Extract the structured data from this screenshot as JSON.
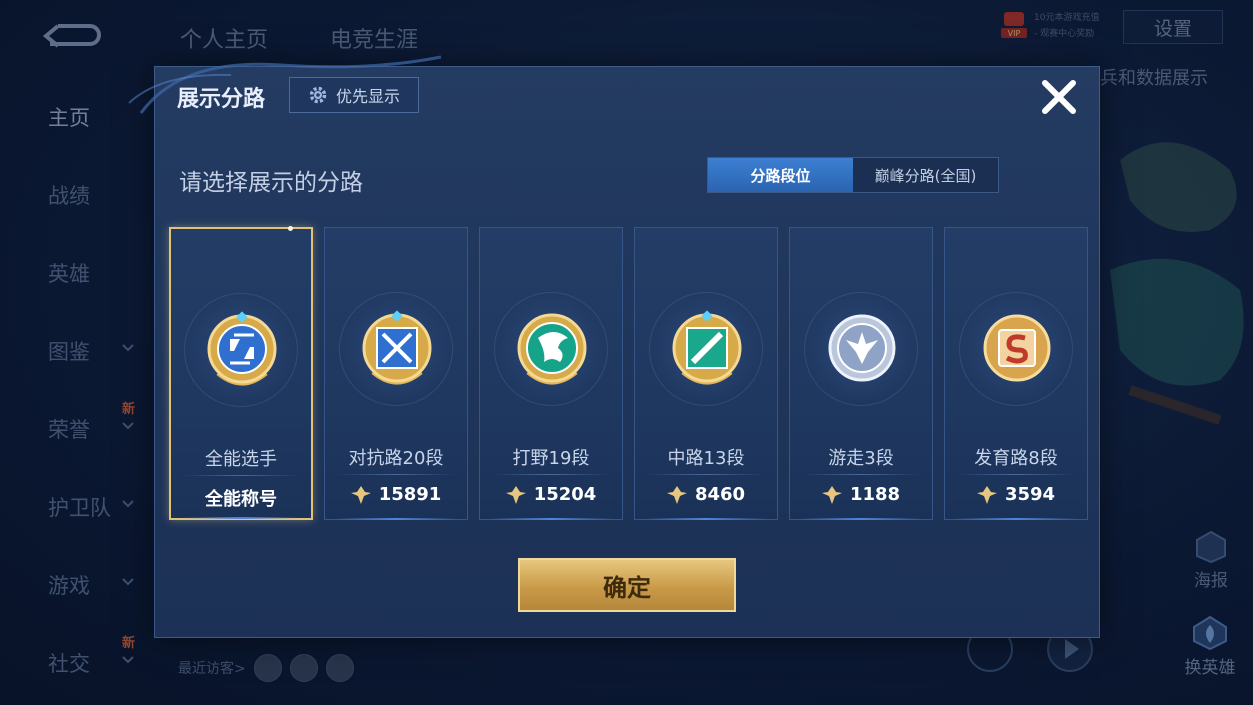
{
  "background": {
    "top_tabs": [
      "个人主页",
      "电竞生涯"
    ],
    "settings_label": "设置",
    "vip_label": "VIP",
    "vip_notes": [
      "10元本游戏充值",
      "- 观赛中心奖励"
    ],
    "right_text": "兵和数据展示",
    "sidebar": [
      {
        "label": "主页",
        "active": true,
        "chevron": false,
        "new": false
      },
      {
        "label": "战绩",
        "active": false,
        "chevron": false,
        "new": false
      },
      {
        "label": "英雄",
        "active": false,
        "chevron": false,
        "new": false
      },
      {
        "label": "图鉴",
        "active": false,
        "chevron": true,
        "new": false
      },
      {
        "label": "荣誉",
        "active": false,
        "chevron": true,
        "new": true
      },
      {
        "label": "护卫队",
        "active": false,
        "chevron": true,
        "new": false
      },
      {
        "label": "游戏",
        "active": false,
        "chevron": true,
        "new": false
      },
      {
        "label": "社交",
        "active": false,
        "chevron": true,
        "new": true
      }
    ],
    "new_tag": "新",
    "recent_visitors": "最近访客>",
    "poster_label": "海报",
    "swap_hero_label": "换英雄"
  },
  "modal": {
    "title": "展示分路",
    "priority_button": "优先显示",
    "subtitle": "请选择展示的分路",
    "toggle": {
      "active": "分路段位",
      "inactive": "巅峰分路(全国)"
    },
    "cards": [
      {
        "name": "全能选手",
        "value": "全能称号",
        "icon": "all-round-emblem-icon",
        "selected": true,
        "is_title": true,
        "color": "#2f6fd0"
      },
      {
        "name": "对抗路20段",
        "value": "15891",
        "icon": "clash-lane-emblem-icon",
        "selected": false,
        "is_title": false,
        "color": "#2f6fd0"
      },
      {
        "name": "打野19段",
        "value": "15204",
        "icon": "jungle-emblem-icon",
        "selected": false,
        "is_title": false,
        "color": "#15a38a"
      },
      {
        "name": "中路13段",
        "value": "8460",
        "icon": "mid-lane-emblem-icon",
        "selected": false,
        "is_title": false,
        "color": "#19a88c"
      },
      {
        "name": "游走3段",
        "value": "1188",
        "icon": "roam-emblem-icon",
        "selected": false,
        "is_title": false,
        "color": "#8fa3c7"
      },
      {
        "name": "发育路8段",
        "value": "3594",
        "icon": "farm-lane-emblem-icon",
        "selected": false,
        "is_title": false,
        "color": "#c0392b"
      }
    ],
    "confirm_button": "确定"
  }
}
